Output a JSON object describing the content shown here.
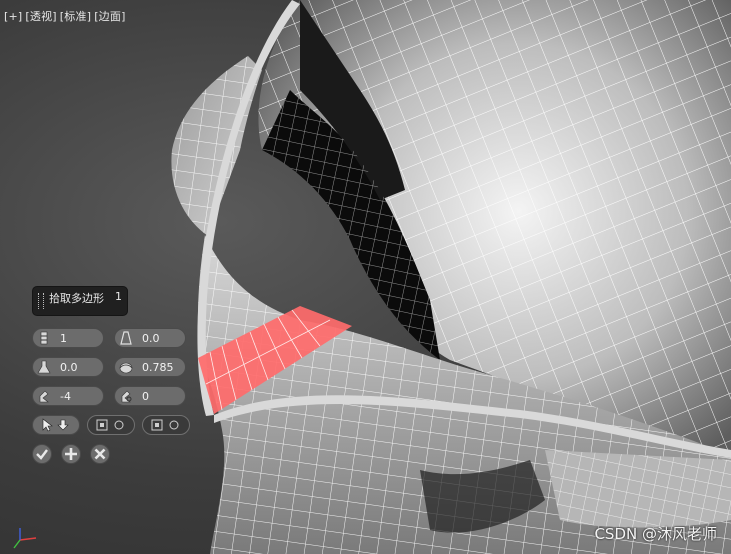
{
  "viewport": {
    "labels": [
      "[+]",
      "[透视]",
      "[标准]",
      "[边面]"
    ]
  },
  "caddy": {
    "title": "拾取多边形",
    "count": "1",
    "fields": {
      "segments": "1",
      "taper": "0.0",
      "bias": "0.0",
      "smooth": "0.785",
      "twist": "-4",
      "rotation": "0"
    }
  },
  "watermark": "CSDN @沐风老师",
  "colors": {
    "highlight": "#ff6b6b",
    "wire": "#ffffff"
  }
}
